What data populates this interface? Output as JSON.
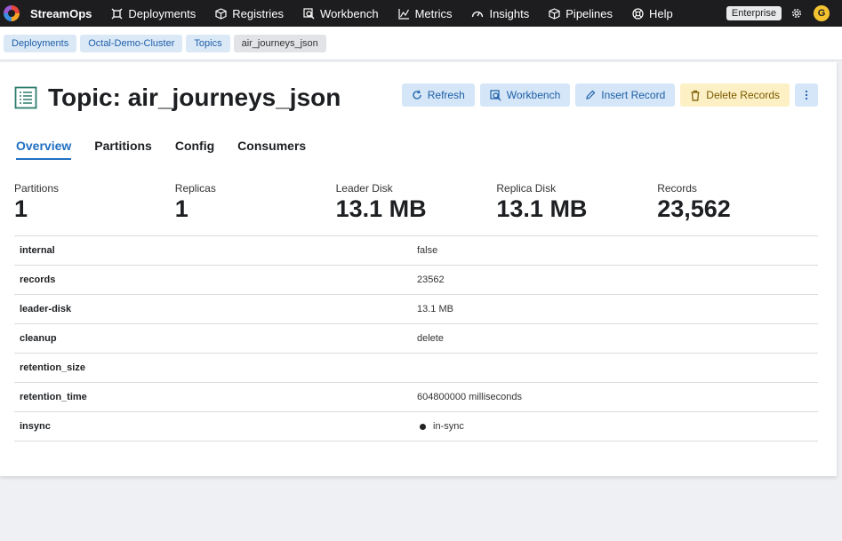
{
  "nav": {
    "brand": "StreamOps",
    "items": [
      {
        "label": "Deployments",
        "icon": "deployments-icon"
      },
      {
        "label": "Registries",
        "icon": "cube-icon"
      },
      {
        "label": "Workbench",
        "icon": "search-icon"
      },
      {
        "label": "Metrics",
        "icon": "chart-icon"
      },
      {
        "label": "Insights",
        "icon": "gauge-icon"
      },
      {
        "label": "Pipelines",
        "icon": "cube-icon"
      },
      {
        "label": "Help",
        "icon": "lifebuoy-icon"
      }
    ],
    "plan_badge": "Enterprise",
    "avatar_initial": "G"
  },
  "breadcrumb": [
    "Deployments",
    "Octal-Demo-Cluster",
    "Topics",
    "air_journeys_json"
  ],
  "page": {
    "title": "Topic: air_journeys_json",
    "actions": {
      "refresh": "Refresh",
      "workbench": "Workbench",
      "insert_record": "Insert Record",
      "delete_records": "Delete Records"
    },
    "tabs": [
      "Overview",
      "Partitions",
      "Config",
      "Consumers"
    ],
    "active_tab": "Overview"
  },
  "stats": [
    {
      "label": "Partitions",
      "value": "1"
    },
    {
      "label": "Replicas",
      "value": "1"
    },
    {
      "label": "Leader Disk",
      "value": "13.1 MB"
    },
    {
      "label": "Replica Disk",
      "value": "13.1 MB"
    },
    {
      "label": "Records",
      "value": "23,562"
    }
  ],
  "properties": [
    {
      "key": "internal",
      "value": "false"
    },
    {
      "key": "records",
      "value": "23562"
    },
    {
      "key": "leader-disk",
      "value": "13.1 MB"
    },
    {
      "key": "cleanup",
      "value": "delete"
    },
    {
      "key": "retention_size",
      "value": ""
    },
    {
      "key": "retention_time",
      "value": "604800000 milliseconds"
    },
    {
      "key": "insync",
      "value": "in-sync"
    }
  ],
  "colors": {
    "topbar": "#1d1d1f",
    "accent": "#1f6fc1",
    "button_blue_bg": "#d4e6f7",
    "button_yellow_bg": "#fdf0c4"
  }
}
